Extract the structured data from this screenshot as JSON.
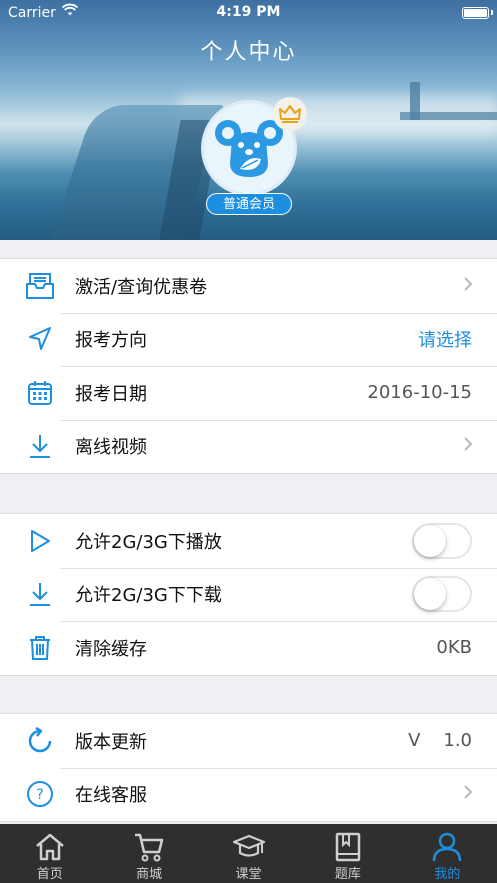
{
  "status_bar": {
    "carrier": "Carrier",
    "time": "4:19 PM"
  },
  "header": {
    "title": "个人中心",
    "member_badge": "普通会员"
  },
  "group1": [
    {
      "label": "激活/查询优惠卷",
      "value": "",
      "chevron": true,
      "icon": "inbox-icon"
    },
    {
      "label": "报考方向",
      "value": "请选择",
      "chevron": false,
      "icon": "location-arrow-icon"
    },
    {
      "label": "报考日期",
      "value": "2016-10-15",
      "chevron": false,
      "icon": "calendar-icon"
    },
    {
      "label": "离线视频",
      "value": "",
      "chevron": true,
      "icon": "download-icon"
    }
  ],
  "group2": [
    {
      "label": "允许2G/3G下播放",
      "toggle": false,
      "icon": "play-icon"
    },
    {
      "label": "允许2G/3G下下载",
      "toggle": false,
      "icon": "download-icon"
    },
    {
      "label": "清除缓存",
      "value": "0KB",
      "icon": "trash-icon"
    }
  ],
  "group3": [
    {
      "label": "版本更新",
      "value": "V    1.0",
      "icon": "refresh-icon"
    },
    {
      "label": "在线客服",
      "value": "",
      "chevron": true,
      "icon": "help-icon"
    }
  ],
  "tabbar": [
    {
      "label": "首页",
      "icon": "home-icon",
      "active": false
    },
    {
      "label": "商城",
      "icon": "cart-icon",
      "active": false
    },
    {
      "label": "课堂",
      "icon": "graduation-cap-icon",
      "active": false
    },
    {
      "label": "题库",
      "icon": "book-icon",
      "active": false
    },
    {
      "label": "我的",
      "icon": "person-icon",
      "active": true
    }
  ],
  "colors": {
    "accent": "#1d8fe0",
    "tabbar_bg": "#2f2f2f",
    "page_bg": "#efeff4"
  }
}
